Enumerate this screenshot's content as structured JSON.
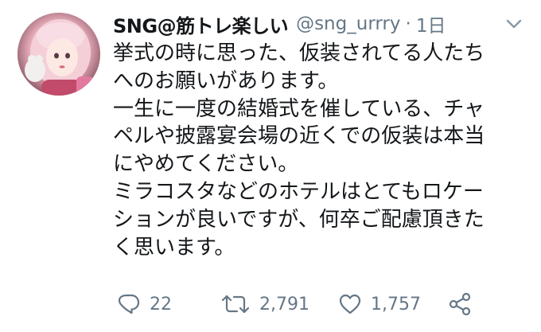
{
  "tweet": {
    "display_name": "SNG@筋トレ楽しい",
    "handle": "@sng_urrry",
    "separator": "·",
    "time": "1日",
    "lines": [
      "挙式の時に思った、仮装されてる人たち",
      "へのお願いがあります。",
      "一生に一度の結婚式を催している、チャ",
      "ペルや披露宴会場の近くでの仮装は本当",
      "にやめてください。",
      "ミラコスタなどのホテルはとてもロケー",
      "ションが良いですが、何卒ご配慮頂きた",
      "く思います。"
    ],
    "actions": {
      "reply_count": "22",
      "retweet_count": "2,791",
      "like_count": "1,757"
    }
  },
  "icons": {
    "menu": "chevron-down-icon",
    "reply": "reply-icon",
    "retweet": "retweet-icon",
    "like": "heart-icon",
    "share": "share-icon"
  },
  "colors": {
    "text": "#14171a",
    "secondary": "#657786",
    "background": "#ffffff"
  }
}
